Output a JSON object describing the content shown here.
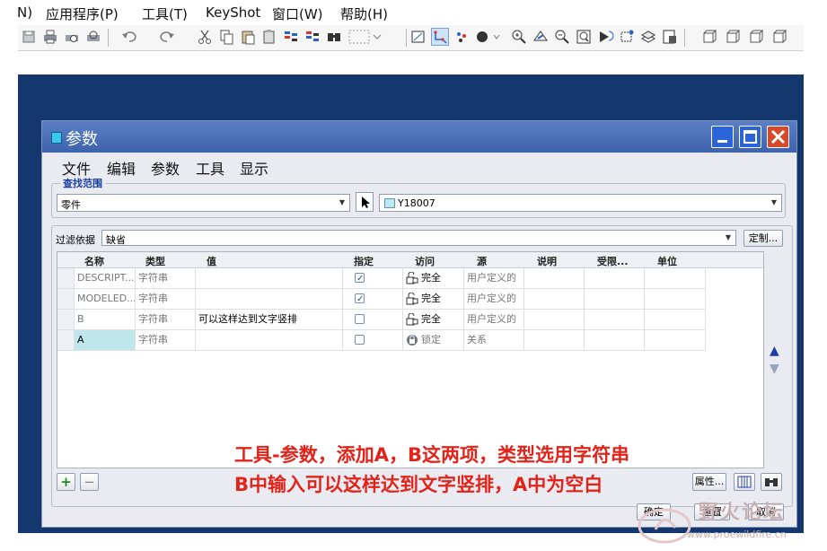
{
  "app_menu": {
    "cut_item": "N)",
    "items": [
      "应用程序(P)",
      "工具(T)",
      "KeyShot",
      "窗口(W)",
      "帮助(H)"
    ]
  },
  "toolbar": {
    "icons": [
      "save-icon",
      "print-icon",
      "print-preview-icon",
      "send-icon",
      "undo-icon",
      "redo-icon",
      "cut-icon",
      "copy-icon",
      "paste-icon",
      "paste-special-icon",
      "regenerate-icon",
      "find-icon",
      "select-box-icon",
      "datum-plane-icon",
      "datum-axis-icon",
      "datum-point-icon",
      "shading-icon",
      "zoom-in-icon",
      "pan-icon",
      "zoom-out-icon",
      "refit-icon",
      "spin-icon",
      "annotation-icon",
      "layer-icon",
      "view-manager-icon",
      "view-cube-icon"
    ]
  },
  "dialog": {
    "title": "参数",
    "menu": [
      "文件",
      "编辑",
      "参数",
      "工具",
      "显示"
    ],
    "scope_group_title": "查找范围",
    "scope_value": "零件",
    "model_value": "Y18007",
    "filter_label": "过滤依据",
    "filter_value": "缺省",
    "customize_button": "定制...",
    "table": {
      "columns": [
        "名称",
        "类型",
        "值",
        "指定",
        "访问",
        "源",
        "说明",
        "受限...",
        "单位"
      ],
      "rows": [
        {
          "name": "DESCRIPT...",
          "type": "字符串",
          "value": "",
          "designated": true,
          "access": "完全",
          "source": "用户定义的"
        },
        {
          "name": "MODELED...",
          "type": "字符串",
          "value": "",
          "designated": true,
          "access": "完全",
          "source": "用户定义的"
        },
        {
          "name": "B",
          "type": "字符串",
          "value": "可以这样达到文字竖排",
          "designated": false,
          "access": "完全",
          "source": "用户定义的"
        },
        {
          "name": "A",
          "type": "字符串",
          "value": "",
          "designated": false,
          "access": "锁定",
          "source": "关系"
        }
      ]
    },
    "add_label": "+",
    "remove_label": "−",
    "properties_button": "属性...",
    "ok_button": "确定",
    "reset_button": "重置",
    "cancel_button": "取消"
  },
  "annotation": {
    "line1": "工具-参数，添加A，B这两项，类型选用字符串",
    "line2": "B中输入可以这样达到文字竖排，A中为空白"
  },
  "watermark": {
    "main": "野火论坛",
    "sub": "www.proewildfire.cn"
  },
  "colors": {
    "workspace": "#14386e",
    "titlebar": "#4a70b8",
    "annotation": "#e2231a",
    "selected_cell": "#bfe6ea"
  }
}
